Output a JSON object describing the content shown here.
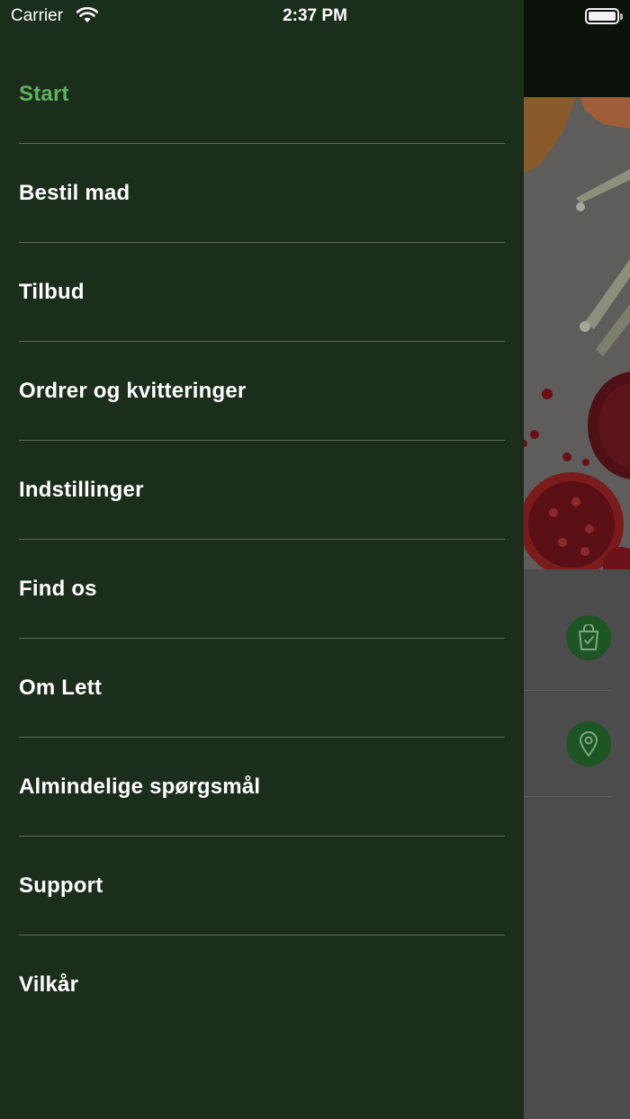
{
  "status_bar": {
    "carrier": "Carrier",
    "time": "2:37 PM"
  },
  "drawer_menu": {
    "active_color": "#5cb35c",
    "background_color": "#1b2e1b",
    "items": [
      {
        "label": "Start",
        "active": true
      },
      {
        "label": "Bestil mad",
        "active": false
      },
      {
        "label": "Tilbud",
        "active": false
      },
      {
        "label": "Ordrer og kvitteringer",
        "active": false
      },
      {
        "label": "Indstillinger",
        "active": false
      },
      {
        "label": "Find os",
        "active": false
      },
      {
        "label": "Om Lett",
        "active": false
      },
      {
        "label": "Almindelige spørgsmål",
        "active": false
      },
      {
        "label": "Support",
        "active": false
      },
      {
        "label": "Vilkår",
        "active": false
      }
    ]
  },
  "background_screen": {
    "accent_color": "#1d5524",
    "actions": [
      {
        "icon": "shopping-bag-check-icon"
      },
      {
        "icon": "location-pin-icon"
      }
    ]
  }
}
